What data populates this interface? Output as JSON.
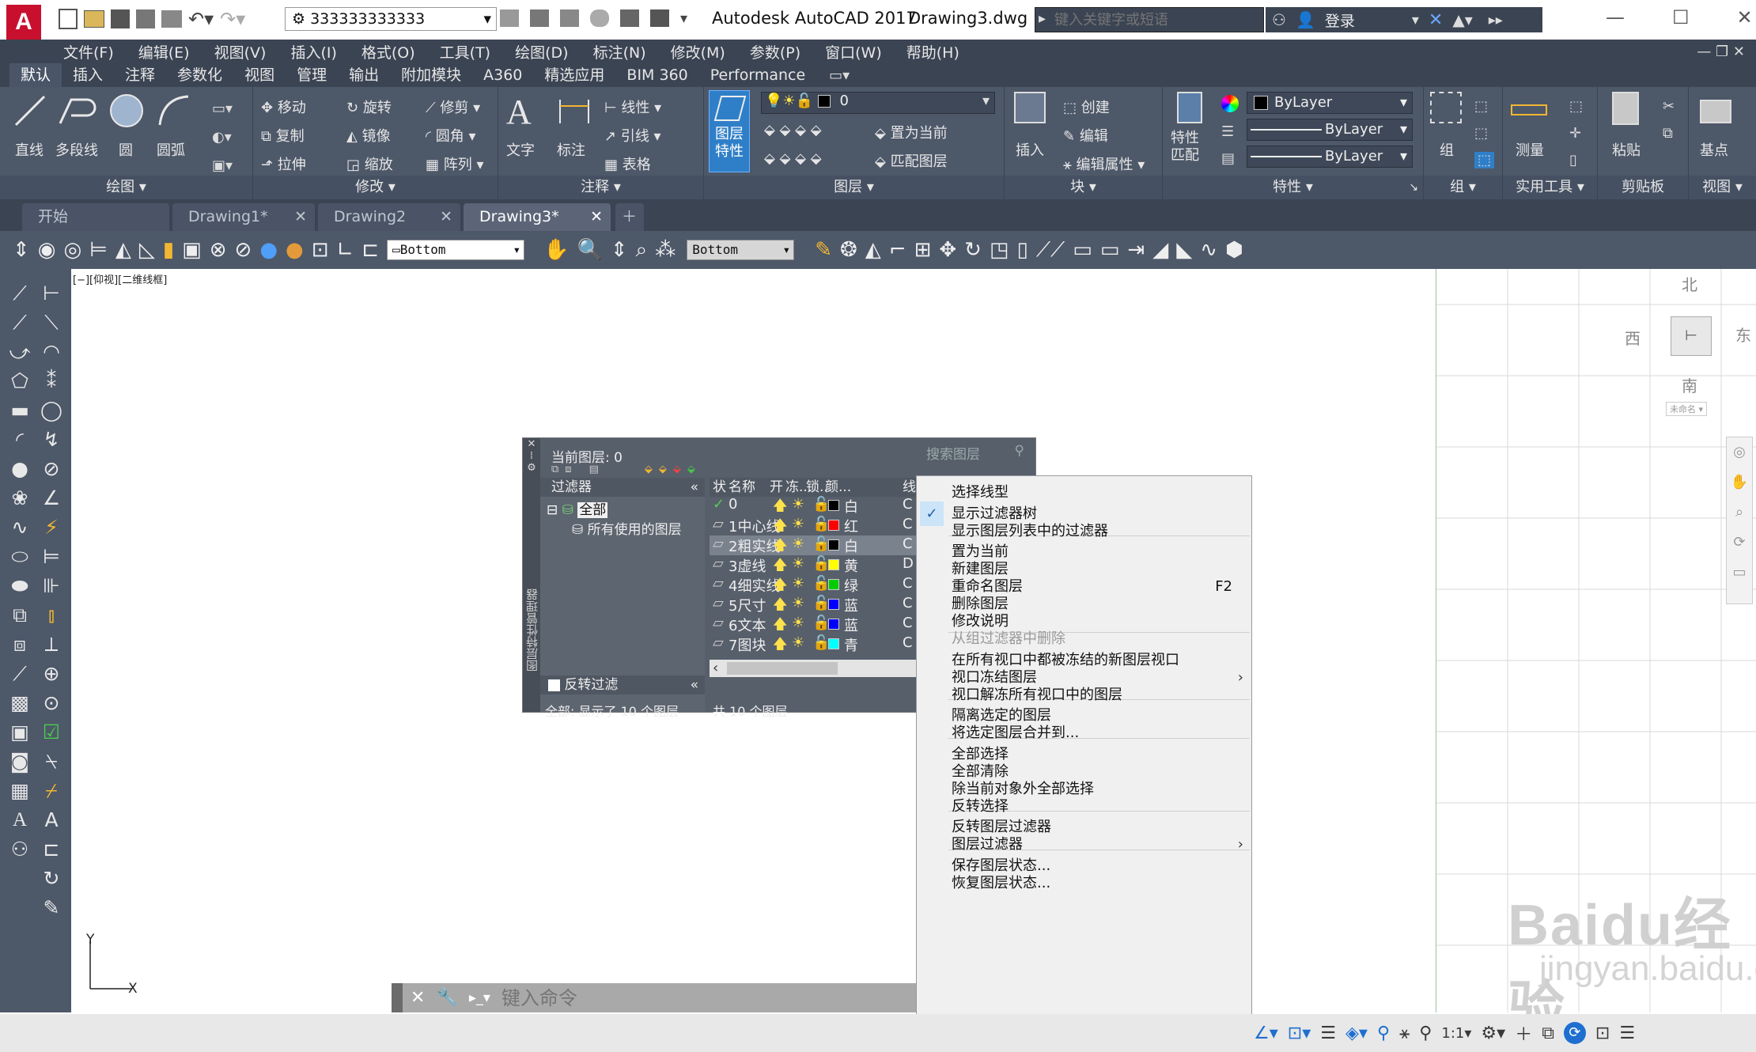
{
  "titlebar": {
    "workspace": "333333333333",
    "app_title": "Autodesk AutoCAD 2017",
    "doc_title": "Drawing3.dwg",
    "search_placeholder": "键入关键字或短语",
    "login": "登录"
  },
  "menu": [
    "文件(F)",
    "编辑(E)",
    "视图(V)",
    "插入(I)",
    "格式(O)",
    "工具(T)",
    "绘图(D)",
    "标注(N)",
    "修改(M)",
    "参数(P)",
    "窗口(W)",
    "帮助(H)"
  ],
  "ribbon_tabs": [
    "默认",
    "插入",
    "注释",
    "参数化",
    "视图",
    "管理",
    "输出",
    "附加模块",
    "A360",
    "精选应用",
    "BIM 360",
    "Performance"
  ],
  "ribbon": {
    "draw": {
      "line": "直线",
      "polyline": "多段线",
      "circle": "圆",
      "arc": "圆弧",
      "label": "绘图"
    },
    "modify": {
      "move": "移动",
      "rotate": "旋转",
      "trim": "修剪",
      "copy": "复制",
      "mirror": "镜像",
      "fillet": "圆角",
      "stretch": "拉伸",
      "scale": "缩放",
      "array": "阵列",
      "label": "修改"
    },
    "annot": {
      "text": "文字",
      "dim": "标注",
      "linear": "线性",
      "leader": "引线",
      "table": "表格",
      "label": "注释"
    },
    "layers": {
      "props": "图层\n特性",
      "current": "0",
      "make_current": "置为当前",
      "match": "匹配图层",
      "label": "图层"
    },
    "block": {
      "insert": "插入",
      "create": "创建",
      "edit": "编辑",
      "edit_attr": "编辑属性",
      "label": "块"
    },
    "props": {
      "match": "特性\n匹配",
      "color": "ByLayer",
      "linetype": "ByLayer",
      "lineweight": "ByLayer",
      "label": "特性"
    },
    "groups": {
      "group": "组",
      "label": "组"
    },
    "util": {
      "measure": "测量",
      "label": "实用工具"
    },
    "clip": {
      "paste": "粘贴",
      "label": "剪贴板"
    },
    "view": {
      "base": "基点",
      "label": "视图"
    }
  },
  "doc_tabs": [
    "开始",
    "Drawing1*",
    "Drawing2",
    "Drawing3*"
  ],
  "view_toolbar": {
    "view1": "Bottom",
    "view2": "Bottom"
  },
  "viewport_label": "[−][仰视][二维线框]",
  "ucs": {
    "x": "X",
    "y": "Y"
  },
  "command": {
    "placeholder": "键入命令"
  },
  "layer_palette": {
    "current": "当前图层: 0",
    "search": "搜索图层",
    "side_title": "图层特性管理器",
    "filters_header": "过滤器",
    "tree_all": "全部",
    "tree_used": "所有使用的图层",
    "invert": "反转过滤",
    "col_status": "状",
    "col_name": "名称",
    "col_on": "开",
    "col_freeze": "冻...",
    "col_lock": "锁...",
    "col_color": "颜...",
    "col_lt": "线",
    "layers": [
      {
        "name": "0",
        "color": "白",
        "hex": "#000000",
        "lt": "C"
      },
      {
        "name": "1中心线",
        "color": "红",
        "hex": "#ff0000",
        "lt": "C"
      },
      {
        "name": "2粗实线",
        "color": "白",
        "hex": "#000000",
        "lt": "C"
      },
      {
        "name": "3虚线",
        "color": "黄",
        "hex": "#ffff00",
        "lt": "D"
      },
      {
        "name": "4细实线",
        "color": "绿",
        "hex": "#00cc00",
        "lt": "C"
      },
      {
        "name": "5尺寸",
        "color": "蓝",
        "hex": "#0000ff",
        "lt": "C"
      },
      {
        "name": "6文本",
        "color": "蓝",
        "hex": "#0000ff",
        "lt": "C"
      },
      {
        "name": "7图块",
        "color": "青",
        "hex": "#00ffff",
        "lt": "C"
      }
    ],
    "footer_left": "全部: 显示了 10 个图层",
    "footer_right": "共 10 个图层"
  },
  "context_menu": {
    "items": [
      "选择线型",
      "显示过滤器树",
      "显示图层列表中的过滤器",
      "置为当前",
      "新建图层",
      "重命名图层",
      "删除图层",
      "修改说明",
      "从组过滤器中删除",
      "在所有视口中都被冻结的新图层视口",
      "视口冻结图层",
      "视口解冻所有视口中的图层",
      "隔离选定的图层",
      "将选定图层合并到...",
      "全部选择",
      "全部清除",
      "除当前对象外全部选择",
      "反转选择",
      "反转图层过滤器",
      "图层过滤器",
      "保存图层状态...",
      "恢复图层状态..."
    ],
    "shortcut": "F2"
  },
  "viewcube": {
    "north": "北",
    "west": "西",
    "east": "东",
    "south": "南",
    "wcs": "未命名"
  },
  "statusbar": {
    "scale": "1:1"
  },
  "watermark": {
    "brand": "Baidu经验",
    "url": "jingyan.baidu.com"
  }
}
